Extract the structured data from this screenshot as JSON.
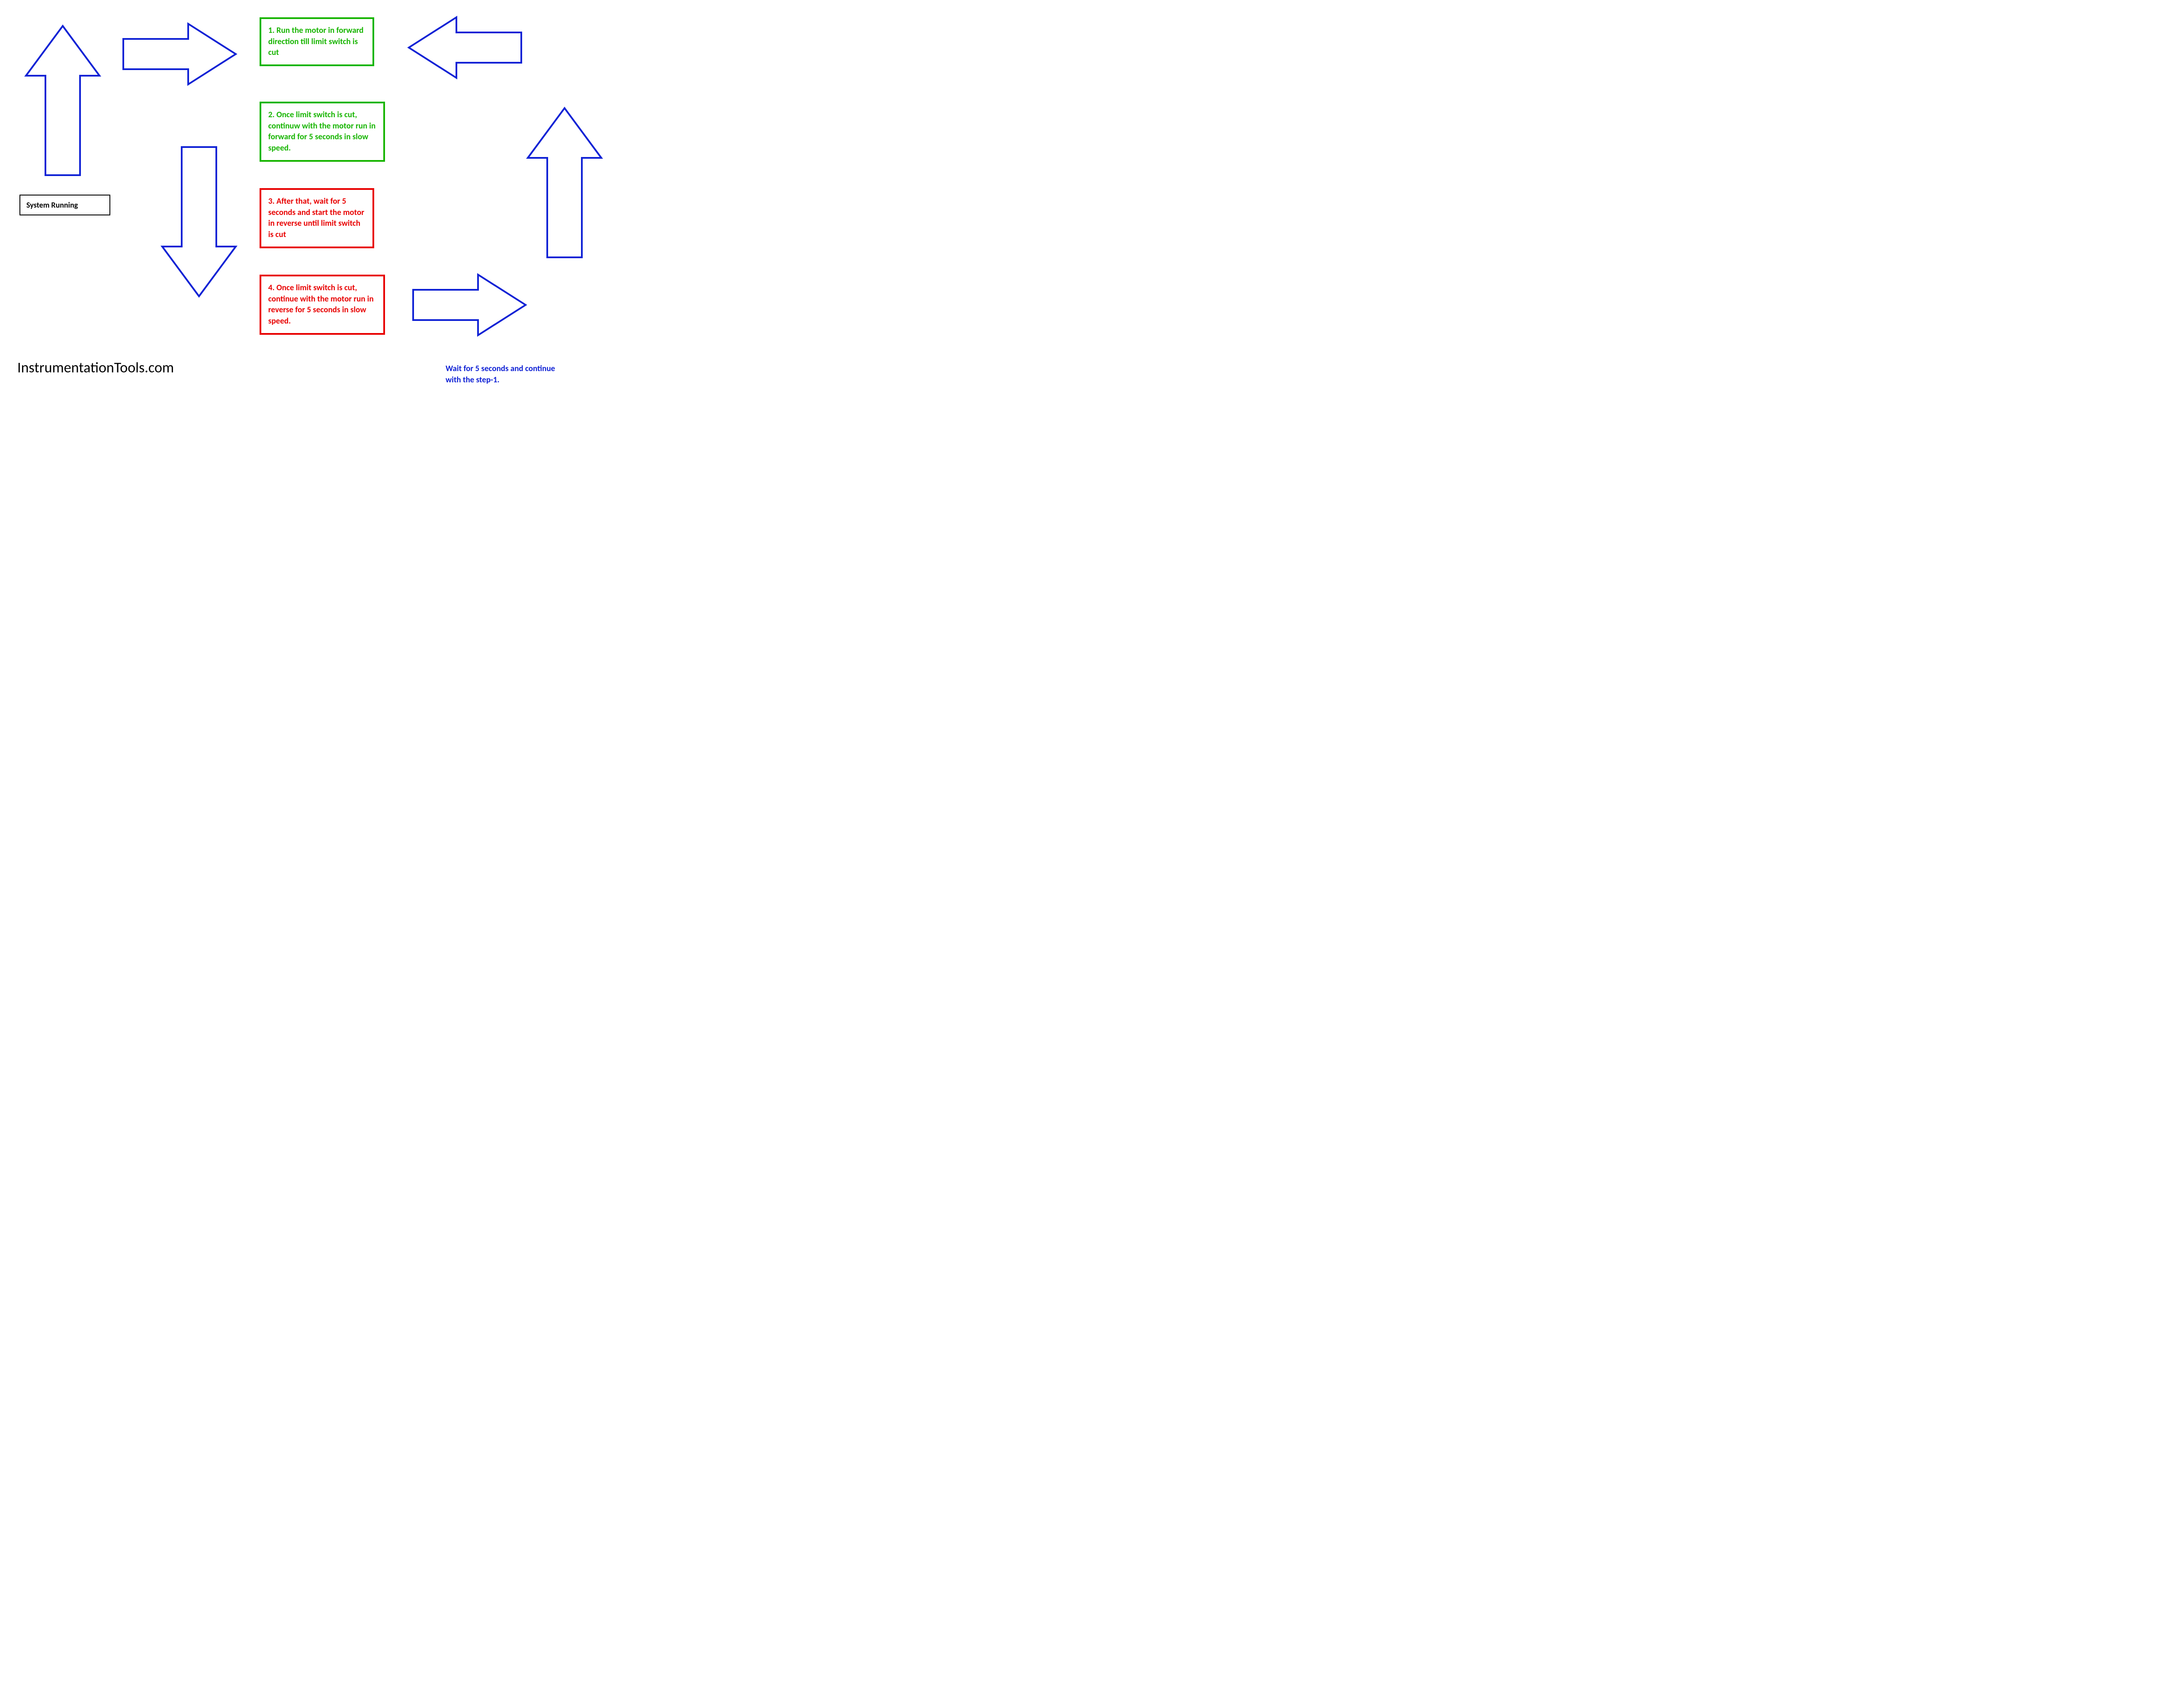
{
  "colors": {
    "blue": "#1022d5",
    "green": "#17b500",
    "red": "#e80000",
    "black": "#000000"
  },
  "label": {
    "system_running": "System Running"
  },
  "steps": [
    "1. Run the motor in forward direction till limit switch is cut",
    "2. Once limit switch is cut, continuw with the motor run in forward for 5 seconds in slow speed.",
    "3. After that, wait for 5 seconds and start the motor in reverse until limit switch is cut",
    "4. Once limit switch is cut, continue with the motor run in reverse for 5 seconds in slow speed."
  ],
  "instruction": "Wait for 5 seconds and continue with the step-1.",
  "source": "InstrumentationTools.com"
}
